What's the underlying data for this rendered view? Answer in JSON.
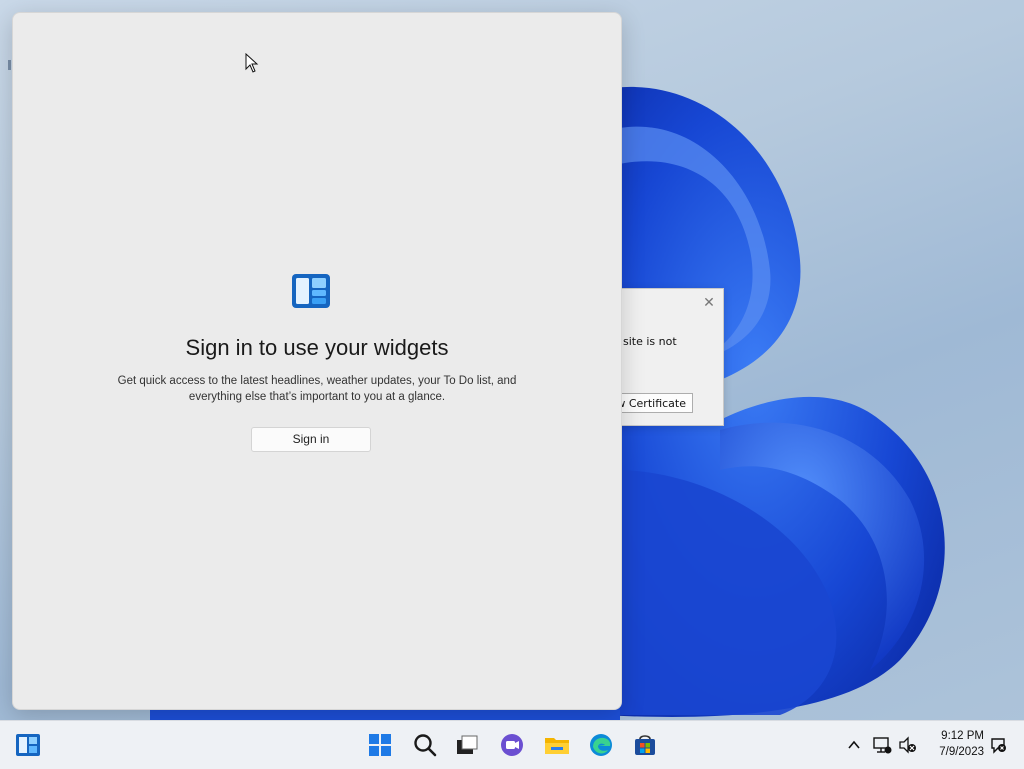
{
  "widgets_panel": {
    "title": "Sign in to use your widgets",
    "description": "Get quick access to the latest headlines, weather updates, your To Do list, and everything else that’s important to you at a glance.",
    "signin_label": "Sign in"
  },
  "background_dialog": {
    "text": "site is not",
    "button_label": "w Certificate",
    "close_glyph": "✕"
  },
  "taskbar": {
    "pinned": [
      "widgets-icon",
      "start-icon",
      "search-icon",
      "task-view-icon",
      "chat-icon",
      "file-explorer-icon",
      "edge-icon",
      "store-icon"
    ],
    "tray": {
      "chevron": "^",
      "time": "9:12 PM",
      "date": "7/9/2023"
    }
  },
  "colors": {
    "accent": "#0a5fd6",
    "panel_bg": "#ebebeb",
    "taskbar_bg": "#eef1f5",
    "wallpaper_blue": "#1f4fd6"
  }
}
